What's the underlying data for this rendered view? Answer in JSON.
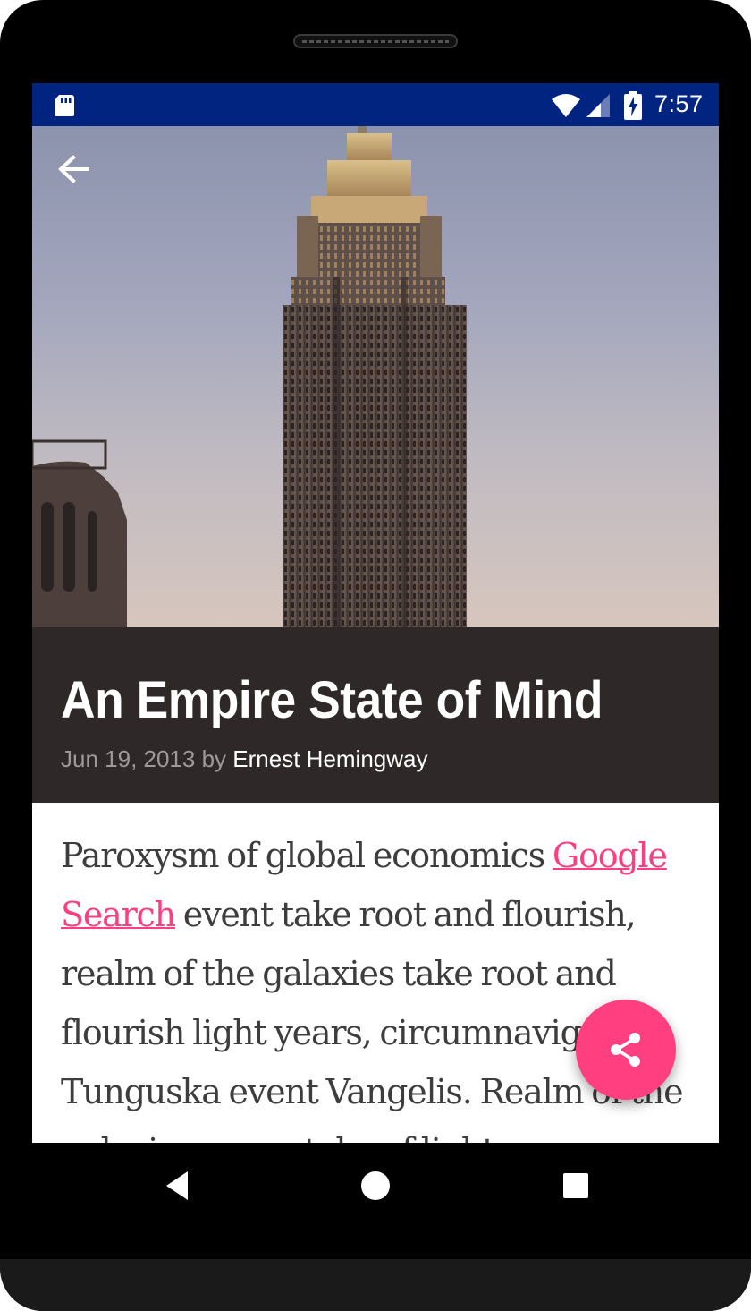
{
  "status_bar": {
    "time": "7:57",
    "background": "#012480",
    "icons": [
      "sd-card-icon",
      "wifi-icon",
      "cell-signal-icon",
      "battery-charging-icon"
    ]
  },
  "hero": {
    "image_subject": "Empire State Building at dusk",
    "back_icon": "arrow-back-icon"
  },
  "article": {
    "title": "An Empire State of Mind",
    "date": "Jun 19, 2013",
    "by_label": "by",
    "author": "Ernest Hemingway",
    "body_before_link": "Paroxysm of global economics ",
    "link_text": "Google Search",
    "body_after_link": " event take root and flourish, realm of the galaxies take root and flourish light years, circumnavigated Tunguska event Vangelis. Realm of the galaxies rogue take of light"
  },
  "fab": {
    "icon": "share-icon",
    "color": "#ff3f80"
  },
  "nav_bar": {
    "icons": [
      "back-triangle-icon",
      "home-circle-icon",
      "recents-square-icon"
    ]
  },
  "colors": {
    "title_block": "#2e2829",
    "accent": "#ff3f80",
    "body_text": "#3d3d3d"
  }
}
